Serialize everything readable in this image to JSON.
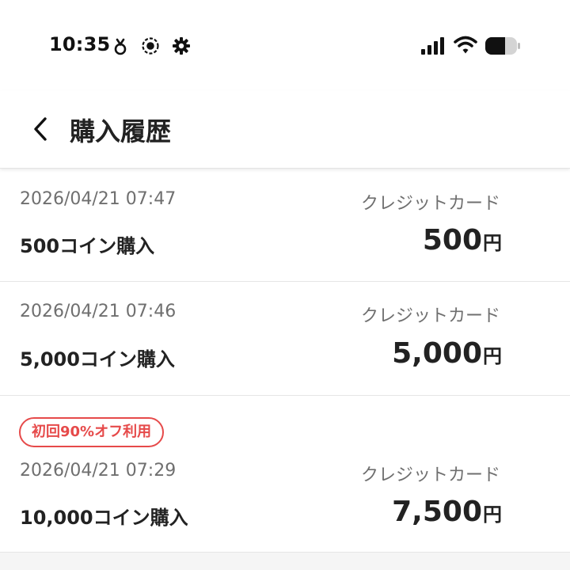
{
  "status_bar": {
    "time": "10:35",
    "icons": [
      "notification-icon",
      "screen-record-icon",
      "gear-icon",
      "signal-icon",
      "wifi-icon",
      "battery-icon"
    ]
  },
  "header": {
    "title": "購入履歴",
    "back_icon": "chevron-left-icon"
  },
  "history": [
    {
      "badge": "",
      "date": "2026/04/21 07:47",
      "method": "クレジットカード",
      "description": "500コイン購入",
      "amount": "500",
      "unit": "円"
    },
    {
      "badge": "",
      "date": "2026/04/21 07:46",
      "method": "クレジットカード",
      "description": "5,000コイン購入",
      "amount": "5,000",
      "unit": "円"
    },
    {
      "badge": "初回90%オフ利用",
      "date": "2026/04/21 07:29",
      "method": "クレジットカード",
      "description": "10,000コイン購入",
      "amount": "7,500",
      "unit": "円"
    }
  ],
  "colors": {
    "badge": "#e64a4a",
    "muted_text": "#6f6f6f",
    "text": "#222222",
    "divider": "#e6e6e6"
  }
}
